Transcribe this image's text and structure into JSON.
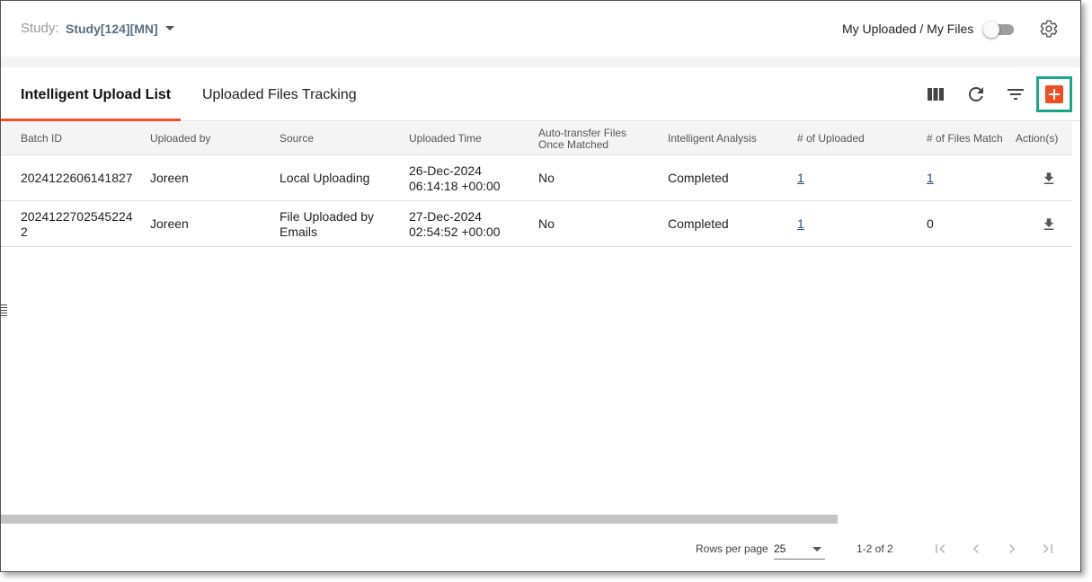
{
  "header": {
    "study_label": "Study:",
    "study_value": "Study[124][MN]",
    "my_files_label": "My Uploaded / My Files",
    "my_files_toggle_on": false
  },
  "tabs": [
    {
      "label": "Intelligent Upload List",
      "active": true
    },
    {
      "label": "Uploaded Files Tracking",
      "active": false
    }
  ],
  "toolbar": {
    "icons": [
      "columns-icon",
      "refresh-icon",
      "filter-icon",
      "add-icon"
    ],
    "accent_color": "#f04f23",
    "highlight_color": "#1aa58d"
  },
  "table": {
    "columns": [
      "Batch ID",
      "Uploaded by",
      "Source",
      "Uploaded Time",
      "Auto-transfer Files Once Matched",
      "Intelligent Analysis",
      "# of Uploaded",
      "# of Files Match",
      "Action(s)"
    ],
    "rows": [
      {
        "batch_id": "2024122606141827",
        "uploaded_by": "Joreen",
        "source": "Local Uploading",
        "time_date": "26-Dec-2024",
        "time_clock": "06:14:18 +00:00",
        "auto_transfer": "No",
        "analysis": "Completed",
        "num_uploaded": "1",
        "num_match": "1"
      },
      {
        "batch_id": "2024122702545224 2",
        "uploaded_by": "Joreen",
        "source": "File Uploaded by Emails",
        "time_date": "27-Dec-2024",
        "time_clock": "02:54:52 +00:00",
        "auto_transfer": "No",
        "analysis": "Completed",
        "num_uploaded": "1",
        "num_match": "0"
      }
    ]
  },
  "pagination": {
    "rows_per_page_label": "Rows per page",
    "rows_per_page_value": "25",
    "range_label": "1-2 of 2"
  }
}
